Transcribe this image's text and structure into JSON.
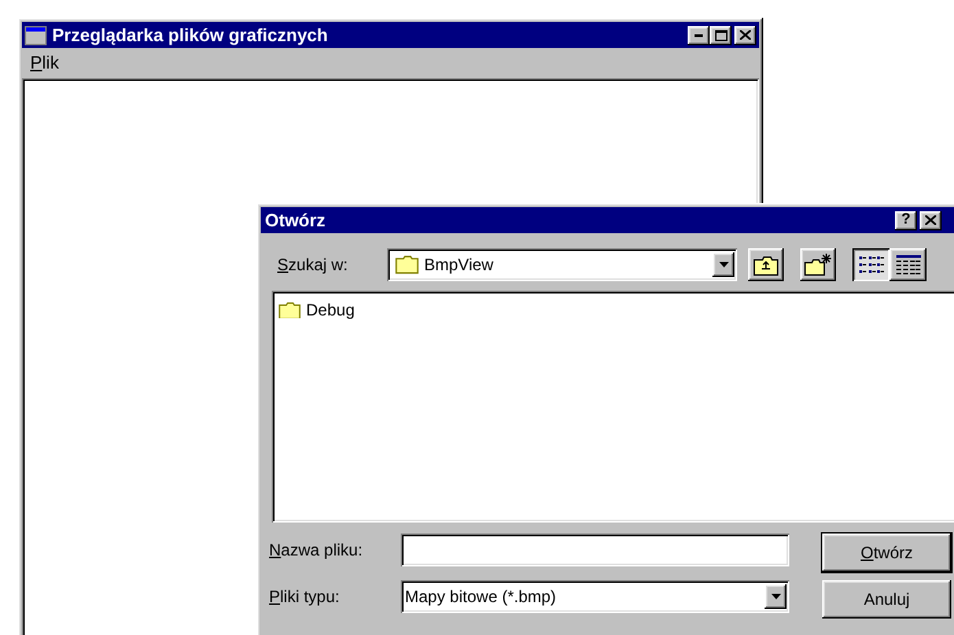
{
  "main_window": {
    "title": "Przeglądarka plików graficznych",
    "menu": [
      {
        "label": "Plik",
        "underline_first": true
      }
    ]
  },
  "dialog": {
    "title": "Otwórz",
    "help_button": "?",
    "look_in": {
      "label": "Szukaj w:",
      "underline_first": true,
      "value": "BmpView"
    },
    "toolbar": [
      {
        "kind": "up",
        "selected": false
      },
      {
        "kind": "new-folder",
        "selected": false
      },
      {
        "kind": "list",
        "selected": true
      },
      {
        "kind": "details",
        "selected": false
      }
    ],
    "files": [
      {
        "name": "Debug",
        "kind": "folder"
      }
    ],
    "file_name": {
      "label": "Nazwa pliku:",
      "underline_first": true
    },
    "file_type": {
      "label": "Pliki typu:",
      "underline_first": true,
      "value": "Mapy bitowe (*.bmp)"
    },
    "buttons": [
      {
        "label": "Otwórz",
        "underline_first": true,
        "default": true
      },
      {
        "label": "Anuluj",
        "underline_first": false,
        "default": false
      }
    ]
  }
}
